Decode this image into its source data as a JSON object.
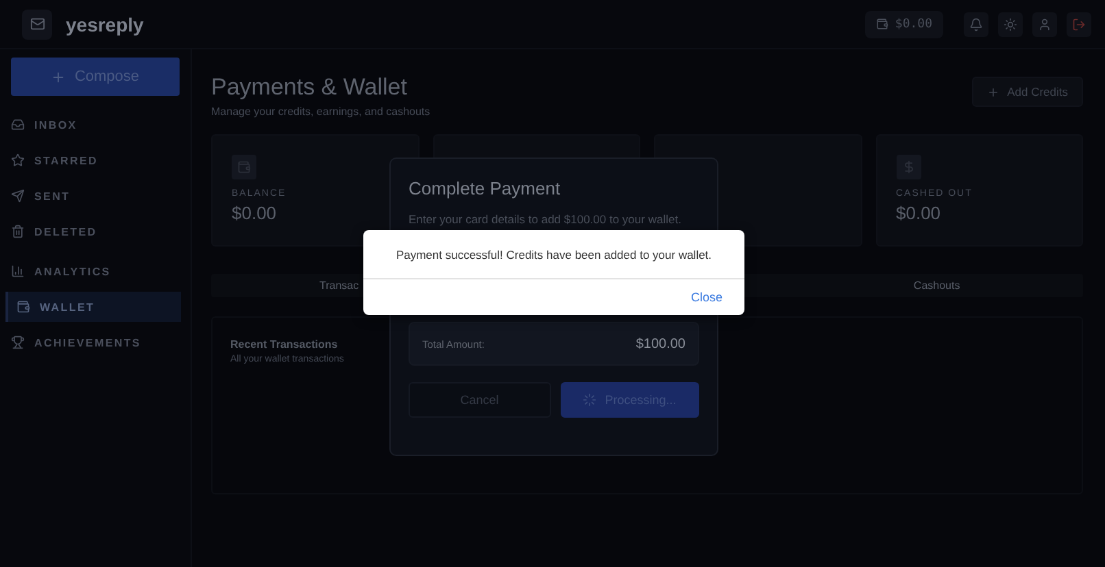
{
  "header": {
    "logo": "yesreply",
    "balance": "$0.00"
  },
  "sidebar": {
    "compose": "Compose",
    "items": [
      {
        "label": "INBOX",
        "selected": false
      },
      {
        "label": "STARRED",
        "selected": false
      },
      {
        "label": "SENT",
        "selected": false
      },
      {
        "label": "DELETED",
        "selected": false
      },
      {
        "label": "ANALYTICS",
        "selected": false
      },
      {
        "label": "WALLET",
        "selected": true
      },
      {
        "label": "ACHIEVEMENTS",
        "selected": false
      }
    ]
  },
  "page": {
    "title": "Payments & Wallet",
    "subtitle": "Manage your credits, earnings, and cashouts",
    "add_credits": "Add Credits",
    "stat_cards": [
      {
        "label": "BALANCE",
        "value": "$0.00"
      },
      {
        "label": "CASHED OUT",
        "value": "$0.00"
      }
    ],
    "tabs": [
      {
        "label": "Transac"
      },
      {
        "label": "Cashouts"
      }
    ],
    "recent": {
      "title": "Recent Transactions",
      "subtitle": "All your wallet transactions"
    }
  },
  "modal": {
    "title": "Complete Payment",
    "description": "Enter your card details to add $100.00 to your wallet.",
    "total_label": "Total Amount:",
    "total_value": "$100.00",
    "cancel": "Cancel",
    "submit": "Processing...",
    "processing": true
  },
  "alert": {
    "message": "Payment successful! Credits have been added to your wallet.",
    "button": "Close"
  }
}
